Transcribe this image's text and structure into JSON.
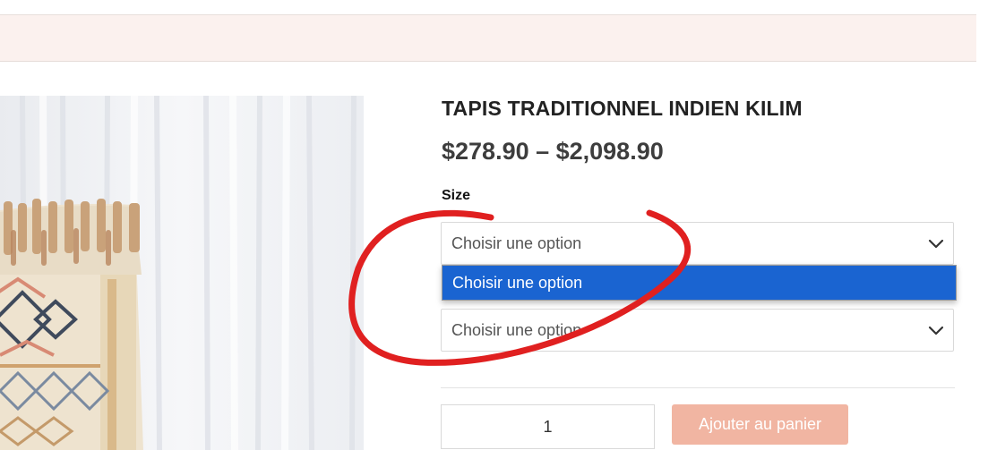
{
  "product": {
    "title": "TAPIS TRADITIONNEL INDIEN KILIM",
    "price_range": "$278.90 – $2,098.90"
  },
  "variations": {
    "size_label": "Size",
    "select1_value": "Choisir une option",
    "select1_open_options": [
      "Choisir une option"
    ],
    "select2_value": "Choisir une option"
  },
  "cart": {
    "quantity": "1",
    "add_to_cart_label": "Ajouter au panier"
  },
  "colors": {
    "accent": "#f1b5a2",
    "highlight": "#1a64d1",
    "notice_bg": "#fbf1ee",
    "annotation": "#e02020"
  },
  "icons": {
    "select_arrow": "chevron-down-icon"
  }
}
